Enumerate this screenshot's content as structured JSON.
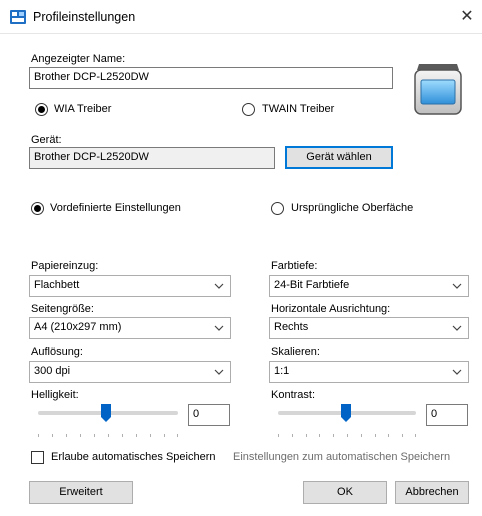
{
  "window": {
    "title": "Profileinstellungen",
    "close_glyph": "✕",
    "icon": "scanner-app-icon"
  },
  "name_section": {
    "label": "Angezeigter Name:",
    "value": "Brother DCP-L2520DW"
  },
  "driver": {
    "wia_label": "WIA Treiber",
    "twain_label": "TWAIN Treiber",
    "selected": "WIA Treiber"
  },
  "device": {
    "label": "Gerät:",
    "value": "Brother DCP-L2520DW",
    "select_button": "Gerät wählen"
  },
  "mode": {
    "predefined_label": "Vordefinierte Einstellungen",
    "original_label": "Ursprüngliche Oberfäche",
    "selected": "Vordefinierte Einstellungen"
  },
  "left_settings": {
    "paper_label": "Papiereinzug:",
    "paper_value": "Flachbett",
    "size_label": "Seitengröße:",
    "size_value": "A4 (210x297 mm)",
    "resolution_label": "Auflösung:",
    "resolution_value": "300 dpi",
    "brightness_label": "Helligkeit:",
    "brightness_value": "0"
  },
  "right_settings": {
    "color_label": "Farbtiefe:",
    "color_value": "24-Bit Farbtiefe",
    "align_label": "Horizontale Ausrichtung:",
    "align_value": "Rechts",
    "scale_label": "Skalieren:",
    "scale_value": "1:1",
    "contrast_label": "Kontrast:",
    "contrast_value": "0"
  },
  "autosave": {
    "checkbox_label": "Erlaube automatisches Speichern",
    "settings_link": "Einstellungen zum automatischen Speichern",
    "checked": false
  },
  "footer": {
    "advanced": "Erweitert",
    "ok": "OK",
    "cancel": "Abbrechen"
  },
  "colors": {
    "accent": "#0078d7",
    "slider_thumb": "#0063c5"
  }
}
